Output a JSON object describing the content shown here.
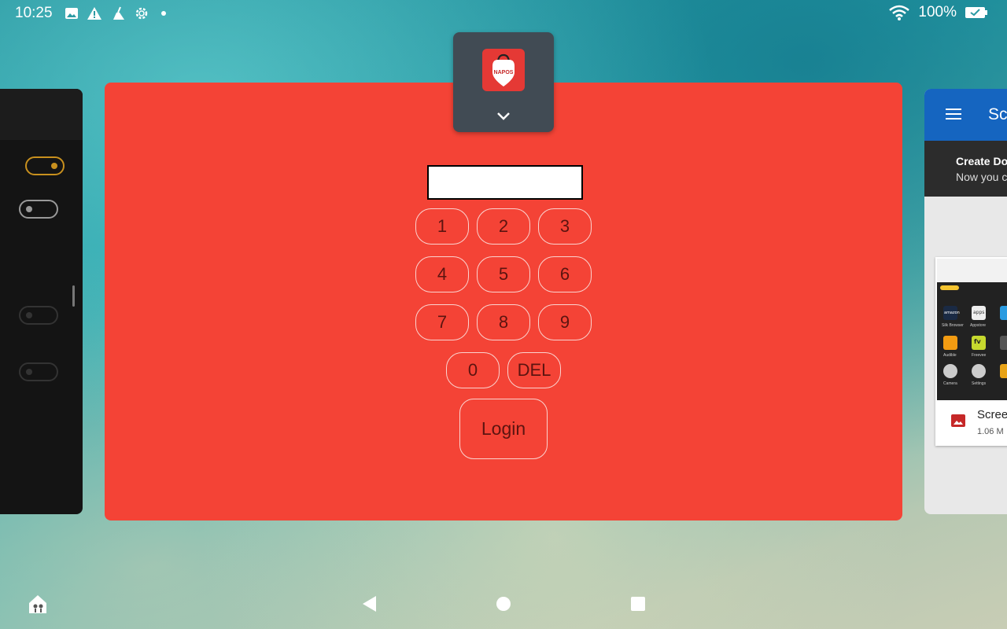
{
  "status_bar": {
    "time": "10:25",
    "battery": "100%",
    "icons_left": [
      "image-icon",
      "warning-icon",
      "broom-icon",
      "settings-icon",
      "dot-icon"
    ],
    "icons_right": [
      "wifi-icon",
      "battery-icon"
    ]
  },
  "main_app": {
    "app_name": "NAPOS",
    "pin_value": "",
    "keys": [
      "1",
      "2",
      "3",
      "4",
      "5",
      "6",
      "7",
      "8",
      "9",
      "0",
      "DEL"
    ],
    "login_label": "Login",
    "background_color": "#f44336"
  },
  "right_app": {
    "title": "Sc",
    "banner_title": "Create Do",
    "banner_subtitle": "Now you c",
    "file_name": "Scree",
    "file_size": "1.06 M",
    "thumb_app_labels": [
      "Silk Browser",
      "Appstore",
      "Audible",
      "Freevee",
      "Camera",
      "Settings"
    ],
    "thumb_app_icons": [
      "amazon",
      "apps",
      "",
      "fv",
      "",
      ""
    ]
  },
  "nav_bar": {
    "items": [
      "home-care-icon",
      "back-icon",
      "home-icon",
      "recents-icon"
    ]
  }
}
